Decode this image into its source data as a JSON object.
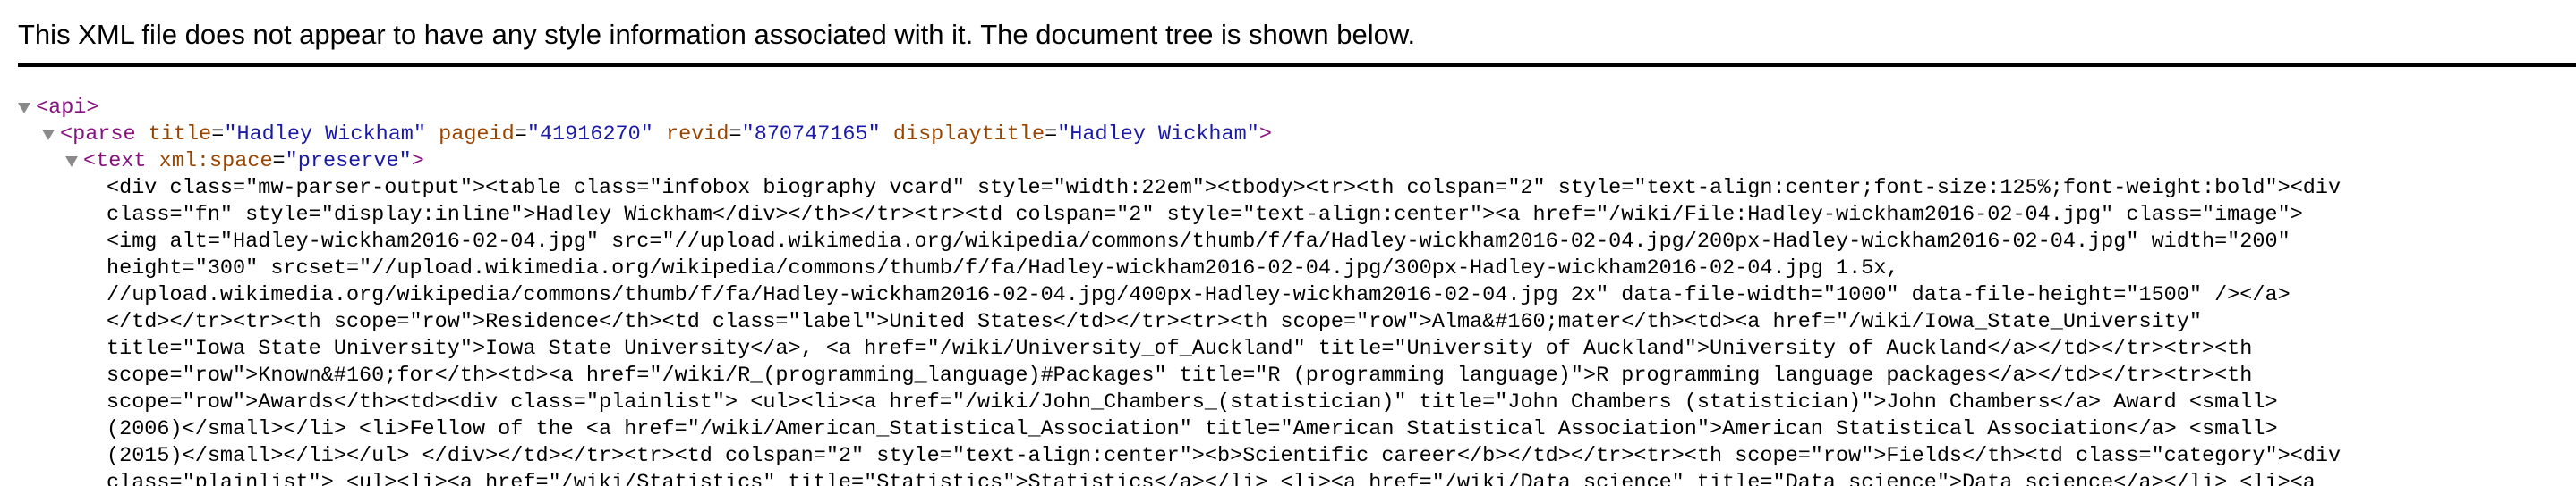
{
  "header": {
    "message": "This XML file does not appear to have any style information associated with it. The document tree is shown below."
  },
  "tree": {
    "api_open": "<api>",
    "parse": {
      "open_prefix": "<parse",
      "attrs": [
        {
          "name": "title",
          "value": "\"Hadley Wickham\""
        },
        {
          "name": "pageid",
          "value": "\"41916270\""
        },
        {
          "name": "revid",
          "value": "\"870747165\""
        },
        {
          "name": "displaytitle",
          "value": "\"Hadley Wickham\""
        }
      ],
      "open_suffix": ">"
    },
    "text_node": {
      "open_prefix": "<text",
      "attr_name": "xml:space",
      "attr_value": "\"preserve\"",
      "open_suffix": ">"
    },
    "content_lines": [
      "<div class=\"mw-parser-output\"><table class=\"infobox biography vcard\" style=\"width:22em\"><tbody><tr><th colspan=\"2\" style=\"text-align:center;font-size:125%;font-weight:bold\"><div",
      "class=\"fn\" style=\"display:inline\">Hadley Wickham</div></th></tr><tr><td colspan=\"2\" style=\"text-align:center\"><a href=\"/wiki/File:Hadley-wickham2016-02-04.jpg\" class=\"image\">",
      "<img alt=\"Hadley-wickham2016-02-04.jpg\" src=\"//upload.wikimedia.org/wikipedia/commons/thumb/f/fa/Hadley-wickham2016-02-04.jpg/200px-Hadley-wickham2016-02-04.jpg\" width=\"200\"",
      "height=\"300\" srcset=\"//upload.wikimedia.org/wikipedia/commons/thumb/f/fa/Hadley-wickham2016-02-04.jpg/300px-Hadley-wickham2016-02-04.jpg 1.5x,",
      "//upload.wikimedia.org/wikipedia/commons/thumb/f/fa/Hadley-wickham2016-02-04.jpg/400px-Hadley-wickham2016-02-04.jpg 2x\" data-file-width=\"1000\" data-file-height=\"1500\" /></a>",
      "</td></tr><tr><th scope=\"row\">Residence</th><td class=\"label\">United States</td></tr><tr><th scope=\"row\">Alma&#160;mater</th><td><a href=\"/wiki/Iowa_State_University\"",
      "title=\"Iowa State University\">Iowa State University</a>, <a href=\"/wiki/University_of_Auckland\" title=\"University of Auckland\">University of Auckland</a></td></tr><tr><th",
      "scope=\"row\">Known&#160;for</th><td><a href=\"/wiki/R_(programming_language)#Packages\" title=\"R (programming language)\">R programming language packages</a></td></tr><tr><th",
      "scope=\"row\">Awards</th><td><div class=\"plainlist\"> <ul><li><a href=\"/wiki/John_Chambers_(statistician)\" title=\"John Chambers (statistician)\">John Chambers</a> Award <small>",
      "(2006)</small></li> <li>Fellow of the <a href=\"/wiki/American_Statistical_Association\" title=\"American Statistical Association\">American Statistical Association</a> <small>",
      "(2015)</small></li></ul> </div></td></tr><tr><td colspan=\"2\" style=\"text-align:center\"><b>Scientific career</b></td></tr><tr><th scope=\"row\">Fields</th><td class=\"category\"><div",
      "class=\"plainlist\"> <ul><li><a href=\"/wiki/Statistics\" title=\"Statistics\">Statistics</a></li> <li><a href=\"/wiki/Data_science\" title=\"Data science\">Data science</a></li> <li><a"
    ]
  }
}
